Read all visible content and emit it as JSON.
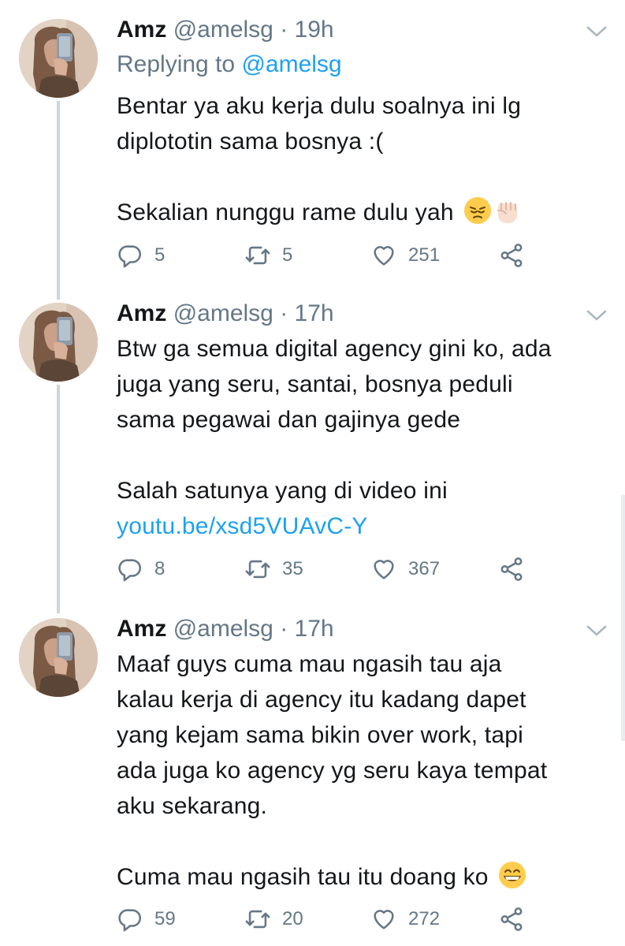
{
  "tweets": [
    {
      "name": "Amz",
      "handle": "@amelsg",
      "separator": "·",
      "time": "19h",
      "replying_prefix": "Replying to",
      "replying_to": "@amelsg",
      "lines": [
        "Bentar ya aku kerja dulu soalnya ini lg",
        "diplototin sama bosnya :(",
        "",
        "Sekalian nunggu rame dulu yah"
      ],
      "emojis": [
        "pensive-face",
        "raised-fist"
      ],
      "replies": "5",
      "retweets": "5",
      "likes": "251"
    },
    {
      "name": "Amz",
      "handle": "@amelsg",
      "separator": "·",
      "time": "17h",
      "lines": [
        "Btw ga semua digital agency gini ko, ada",
        "juga yang seru, santai, bosnya peduli",
        "sama pegawai dan gajinya gede",
        "",
        "Salah satunya yang di video ini"
      ],
      "link": "youtu.be/xsd5VUAvC-Y",
      "replies": "8",
      "retweets": "35",
      "likes": "367"
    },
    {
      "name": "Amz",
      "handle": "@amelsg",
      "separator": "·",
      "time": "17h",
      "lines": [
        "Maaf guys cuma mau ngasih tau aja",
        "kalau kerja di agency itu kadang dapet",
        "yang kejam sama bikin over work, tapi",
        "ada juga ko agency yg seru kaya tempat",
        "aku sekarang.",
        "",
        "Cuma mau ngasih tau itu doang ko"
      ],
      "emojis": [
        "grinning-face"
      ],
      "replies": "59",
      "retweets": "20",
      "likes": "272"
    }
  ],
  "colors": {
    "accent": "#1da1f2",
    "secondary_text": "#657786",
    "thread_line": "#ccd6dd"
  },
  "icons": [
    "reply-icon",
    "retweet-icon",
    "like-icon",
    "share-icon",
    "chevron-down-icon"
  ]
}
